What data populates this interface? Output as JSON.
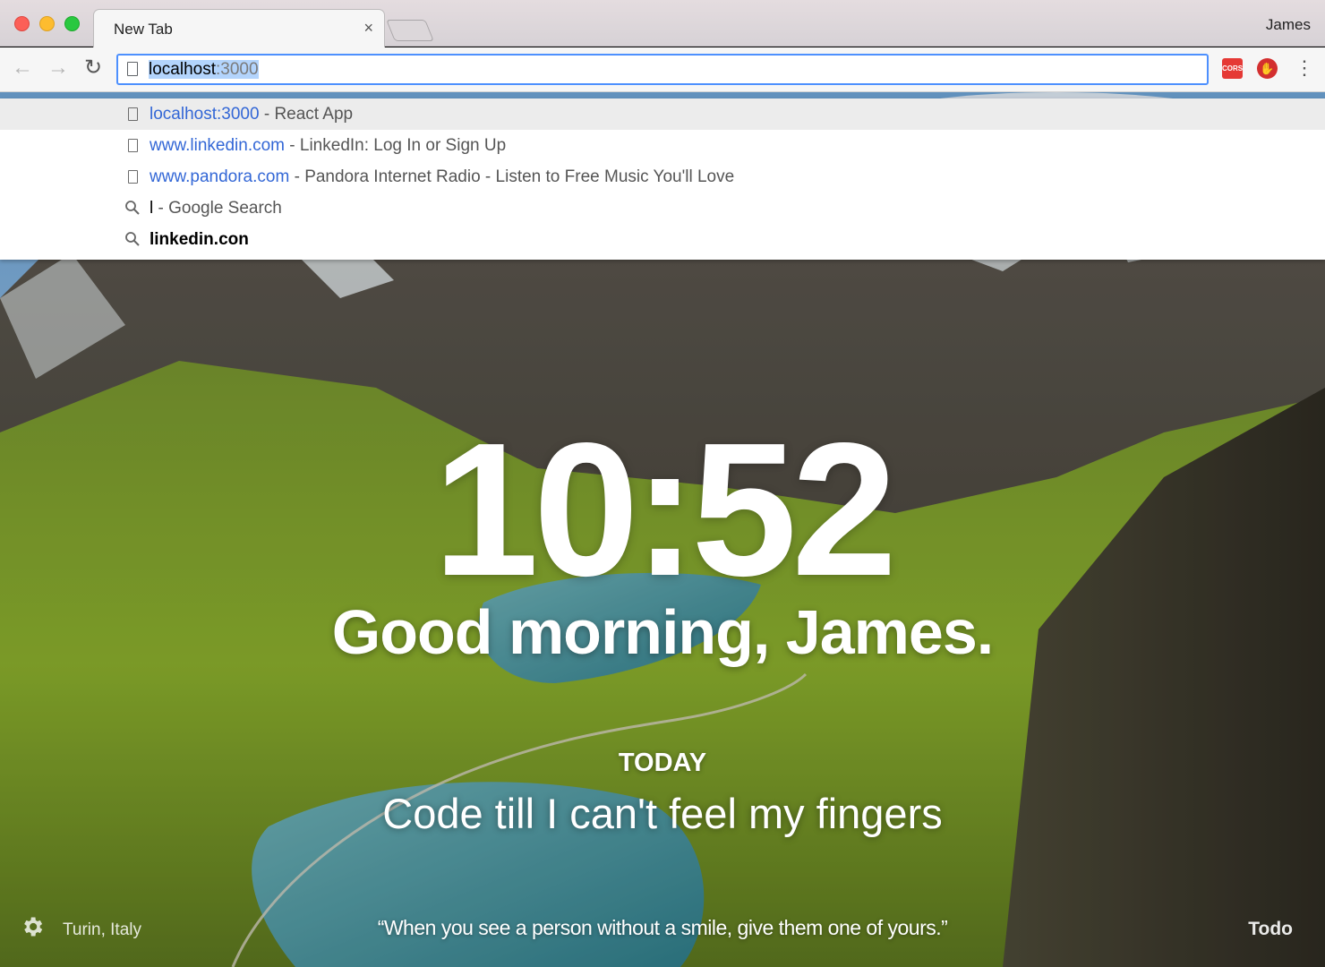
{
  "window": {
    "tab_title": "New Tab",
    "tab_close": "×",
    "profile_name": "James"
  },
  "toolbar": {
    "back_icon": "←",
    "forward_icon": "→",
    "reload_icon": "↻",
    "address_host": "localhost",
    "address_port": ":3000",
    "ext_cors_label": "CORS",
    "ext_stop_icon": "✋",
    "menu_icon": "⋮"
  },
  "suggestions": [
    {
      "icon": "page-icon",
      "url": "localhost:3000",
      "separator": " - ",
      "title": "React App"
    },
    {
      "icon": "page-icon",
      "url": "www.linkedin.com",
      "separator": " - ",
      "title": "LinkedIn: Log In or Sign Up"
    },
    {
      "icon": "page-icon",
      "url": "www.pandora.com",
      "separator": " - ",
      "title": "Pandora Internet Radio - Listen to Free Music You'll Love"
    },
    {
      "icon": "search-icon",
      "query": "l",
      "separator": " - ",
      "title": "Google Search"
    },
    {
      "icon": "search-icon",
      "query": "linkedin.con"
    }
  ],
  "momentum": {
    "time": "10:52",
    "greeting": "Good morning, James.",
    "today_label": "TODAY",
    "focus": "Code till I can't feel my fingers",
    "location": "Turin, Italy",
    "quote": "“When you see a person without a smile, give them one of yours.”",
    "todo": "Todo"
  }
}
